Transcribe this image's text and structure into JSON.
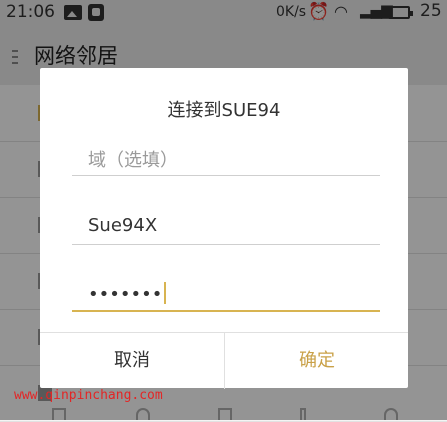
{
  "status": {
    "time": "21:06",
    "net_speed": "0K/s",
    "signal_label": "4G",
    "battery": "25"
  },
  "appbar": {
    "title": "网络邻居"
  },
  "dialog": {
    "title": "连接到SUE94",
    "domain_placeholder": "域（选填）",
    "username": "Sue94X",
    "password_masked": "•••••••",
    "cancel_label": "取消",
    "ok_label": "确定"
  },
  "watermark": "www.qinpinchang.com",
  "colors": {
    "accent": "#d8b451",
    "ok_text": "#c9a148",
    "watermark": "#e32626"
  }
}
